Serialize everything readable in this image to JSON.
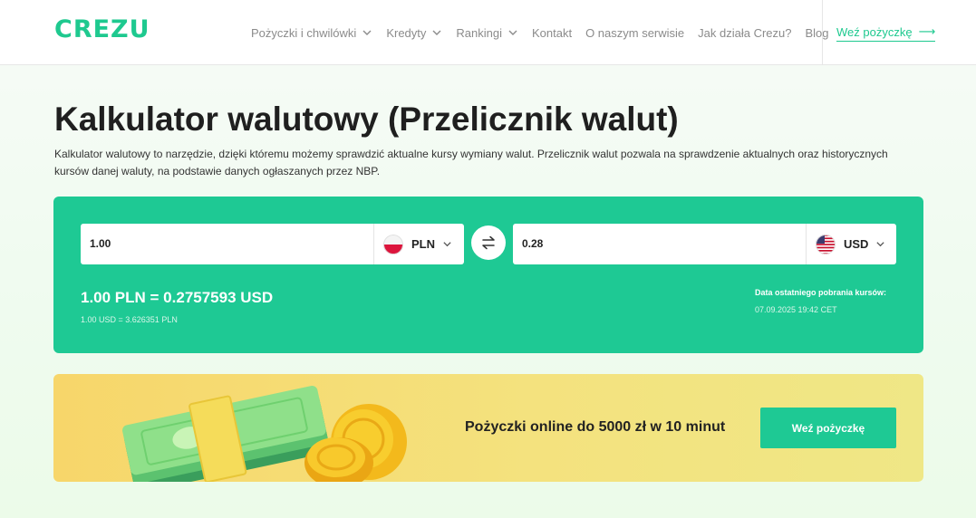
{
  "header": {
    "logo": "CREZU",
    "nav": [
      {
        "label": "Pożyczki i chwilówki",
        "dropdown": true
      },
      {
        "label": "Kredyty",
        "dropdown": true
      },
      {
        "label": "Rankingi",
        "dropdown": true
      },
      {
        "label": "Kontakt",
        "dropdown": false
      },
      {
        "label": "O naszym serwisie",
        "dropdown": false
      },
      {
        "label": "Jak działa Crezu?",
        "dropdown": false
      },
      {
        "label": "Blog",
        "dropdown": false
      }
    ],
    "cta_label": "Weź pożyczkę",
    "cta_arrow": "⟶"
  },
  "page": {
    "title": "Kalkulator walutowy (Przelicznik walut)",
    "description": "Kalkulator walutowy to narzędzie, dzięki któremu możemy sprawdzić aktualne kursy wymiany walut. Przelicznik walut pozwala na sprawdzenie aktualnych oraz historycznych kursów danej waluty, na podstawie danych ogłaszanych przez NBP."
  },
  "calculator": {
    "from": {
      "value": "1.00",
      "currency": "PLN",
      "flag": "poland-flag-icon"
    },
    "to": {
      "value": "0.28",
      "currency": "USD",
      "flag": "usa-flag-icon"
    },
    "swap_icon": "swap-arrows-icon",
    "rate_main": "1.00 PLN = 0.2757593 USD",
    "rate_reverse": "1.00 USD = 3.626351 PLN",
    "last_update_label": "Data ostatniego pobrania kursów:",
    "last_update_value": "07.09.2025 19:42 CET"
  },
  "promo": {
    "text": "Pożyczki online do 5000 zł w 10 minut",
    "button_label": "Weź pożyczkę",
    "art": "money-and-coins-illustration"
  },
  "colors": {
    "brand": "#1ec98f",
    "calc_bg": "#1ec994",
    "promo_bg": "#f4e27e"
  }
}
